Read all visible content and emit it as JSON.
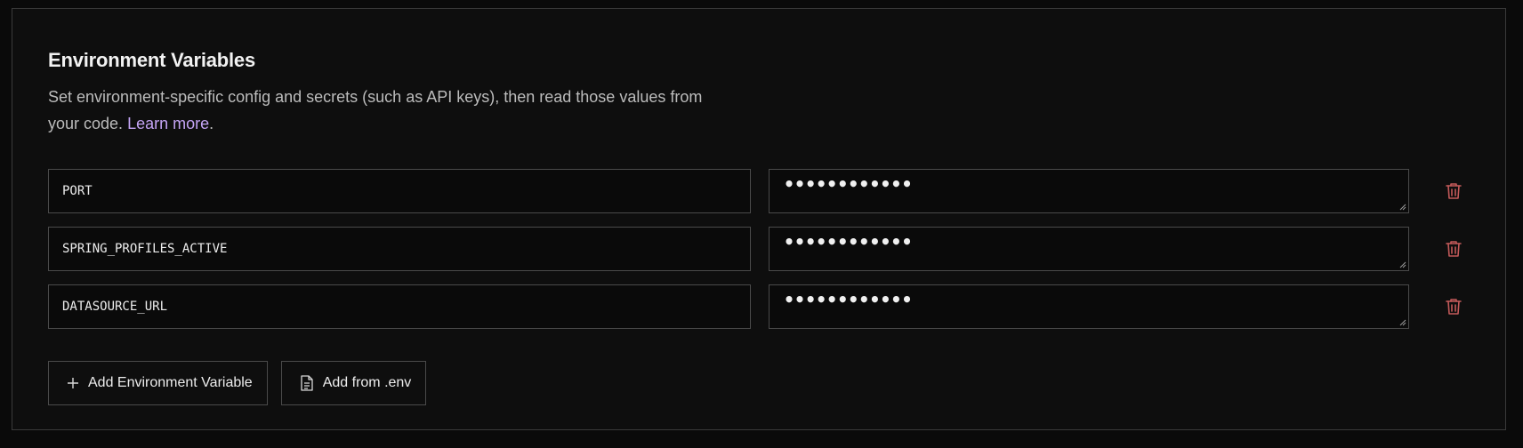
{
  "section": {
    "title": "Environment Variables",
    "description": "Set environment-specific config and secrets (such as API keys), then read those values from your code. ",
    "learn_more": "Learn more",
    "trailing_period": "."
  },
  "variables": [
    {
      "key": "PORT",
      "value_masked": "••••••••••••"
    },
    {
      "key": "SPRING_PROFILES_ACTIVE",
      "value_masked": "••••••••••••"
    },
    {
      "key": "DATASOURCE_URL",
      "value_masked": "••••••••••••"
    }
  ],
  "actions": {
    "add_variable": "Add Environment Variable",
    "add_from_env": "Add from .env"
  },
  "colors": {
    "background": "#0a0a0a",
    "border": "#4a4a4a",
    "link": "#c4a4f5",
    "danger": "#c45a5a"
  },
  "icons": {
    "delete": "trash-icon",
    "add": "plus-icon",
    "file": "file-icon"
  }
}
